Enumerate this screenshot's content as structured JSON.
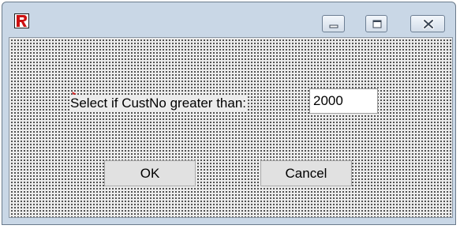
{
  "window": {
    "icon": "report-r-icon",
    "controls": {
      "minimize": "minimize-icon",
      "maximize": "maximize-icon",
      "close": "close-icon"
    }
  },
  "dialog": {
    "prompt_label": "Select if CustNo greater than:",
    "input_value": "2000",
    "ok_label": "OK",
    "cancel_label": "Cancel"
  },
  "colors": {
    "titlebar": "#c9d7e6",
    "client_background": "#ececec",
    "button_face": "#e1e1e1",
    "icon_red": "#cc1111"
  }
}
